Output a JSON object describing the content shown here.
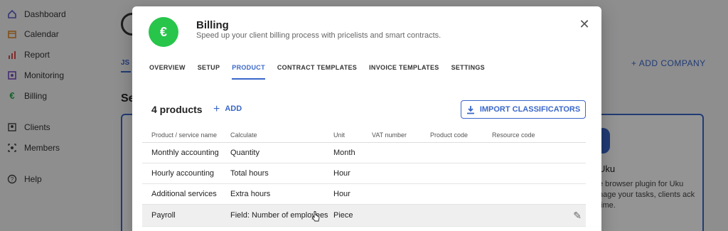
{
  "sidebar": {
    "items": [
      {
        "label": "Dashboard",
        "icon": "home-icon",
        "color": "#5b5fc7"
      },
      {
        "label": "Calendar",
        "icon": "calendar-icon",
        "color": "#e08a2c"
      },
      {
        "label": "Report",
        "icon": "bar-chart-icon",
        "color": "#d94c4c"
      },
      {
        "label": "Monitoring",
        "icon": "monitoring-icon",
        "color": "#7a4fc0"
      },
      {
        "label": "Billing",
        "icon": "euro-icon",
        "color": "#27a84a"
      },
      {
        "label": "Clients",
        "icon": "clients-icon",
        "color": "#444444"
      },
      {
        "label": "Members",
        "icon": "members-icon",
        "color": "#444444"
      },
      {
        "label": "Help",
        "icon": "help-icon",
        "color": "#444444"
      }
    ]
  },
  "background": {
    "tab_label": "JS",
    "heading": "Se",
    "add_company": "ADD COMPANY",
    "card_title": "Uku",
    "card_desc": "e browser plugin for Uku nage your tasks, clients ack time."
  },
  "modal": {
    "badge_symbol": "€",
    "title": "Billing",
    "subtitle": "Speed up your client billing process with pricelists and smart contracts.",
    "close_symbol": "✕",
    "tabs": [
      "OVERVIEW",
      "SETUP",
      "PRODUCT",
      "CONTRACT TEMPLATES",
      "INVOICE TEMPLATES",
      "SETTINGS"
    ],
    "active_tab": "PRODUCT",
    "count_label": "4 products",
    "add_label": "ADD",
    "import_label": "IMPORT CLASSIFICATORS",
    "columns": [
      "Product / service name",
      "Calculate",
      "Unit",
      "VAT number",
      "Product code",
      "Resource code"
    ],
    "rows": [
      {
        "name": "Monthly accounting",
        "calculate": "Quantity",
        "unit": "Month"
      },
      {
        "name": "Hourly accounting",
        "calculate": "Total hours",
        "unit": "Hour"
      },
      {
        "name": "Additional services",
        "calculate": "Extra hours",
        "unit": "Hour"
      },
      {
        "name": "Payroll",
        "calculate": "Field: Number of employees",
        "unit": "Piece"
      }
    ]
  },
  "colors": {
    "accent": "#3a67c9",
    "badge": "#27c54a"
  }
}
